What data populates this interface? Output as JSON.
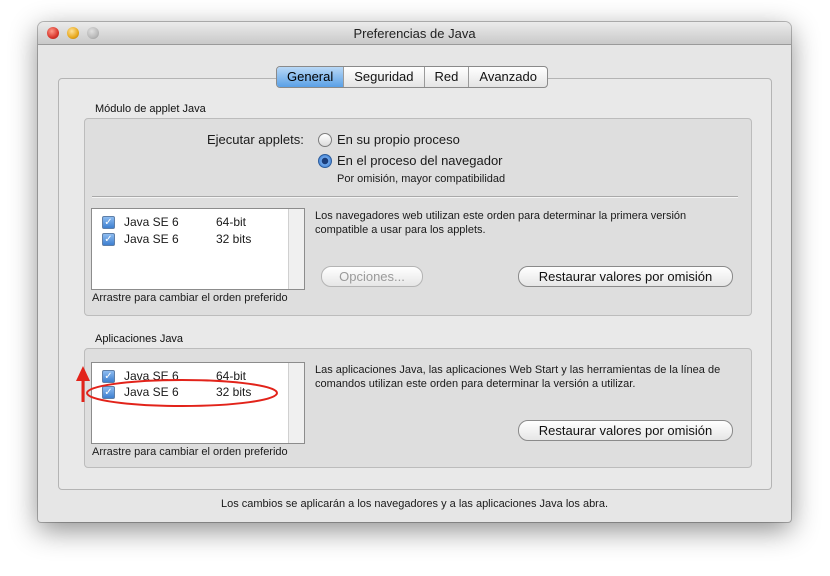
{
  "window": {
    "title": "Preferencias de Java"
  },
  "tabs": [
    {
      "label": "General",
      "active": true
    },
    {
      "label": "Seguridad",
      "active": false
    },
    {
      "label": "Red",
      "active": false
    },
    {
      "label": "Avanzado",
      "active": false
    }
  ],
  "applet": {
    "section_label": "Módulo de applet Java",
    "run_label": "Ejecutar applets:",
    "option_own": "En su propio proceso",
    "option_browser": "En el proceso del navegador",
    "option_browser_note": "Por omisión, mayor compatibilidad",
    "selected_option": "option_browser",
    "list": [
      {
        "name": "Java SE 6",
        "arch": "64-bit",
        "checked": true
      },
      {
        "name": "Java SE 6",
        "arch": "32 bits",
        "checked": true
      }
    ],
    "description": "Los navegadores web utilizan este orden para determinar la primera versión compatible a usar para los applets.",
    "options_button": "Opciones...",
    "restore_button": "Restaurar valores por omisión",
    "drag_hint": "Arrastre para cambiar el orden preferido"
  },
  "apps": {
    "section_label": "Aplicaciones Java",
    "list": [
      {
        "name": "Java SE 6",
        "arch": "64-bit",
        "checked": true
      },
      {
        "name": "Java SE 6",
        "arch": "32 bits",
        "checked": true
      }
    ],
    "description": "Las aplicaciones Java, las aplicaciones Web Start y las herramientas de la línea de comandos utilizan este orden para determinar la versión a utilizar.",
    "restore_button": "Restaurar valores por omisión",
    "drag_hint": "Arrastre para cambiar el orden preferido"
  },
  "footer": "Los cambios se aplicarán a los navegadores y a las aplicaciones Java los abra.",
  "annotation": {
    "arrow_color": "#e2231a",
    "ellipse_color": "#e2231a"
  },
  "icons": {
    "check": "✓"
  }
}
